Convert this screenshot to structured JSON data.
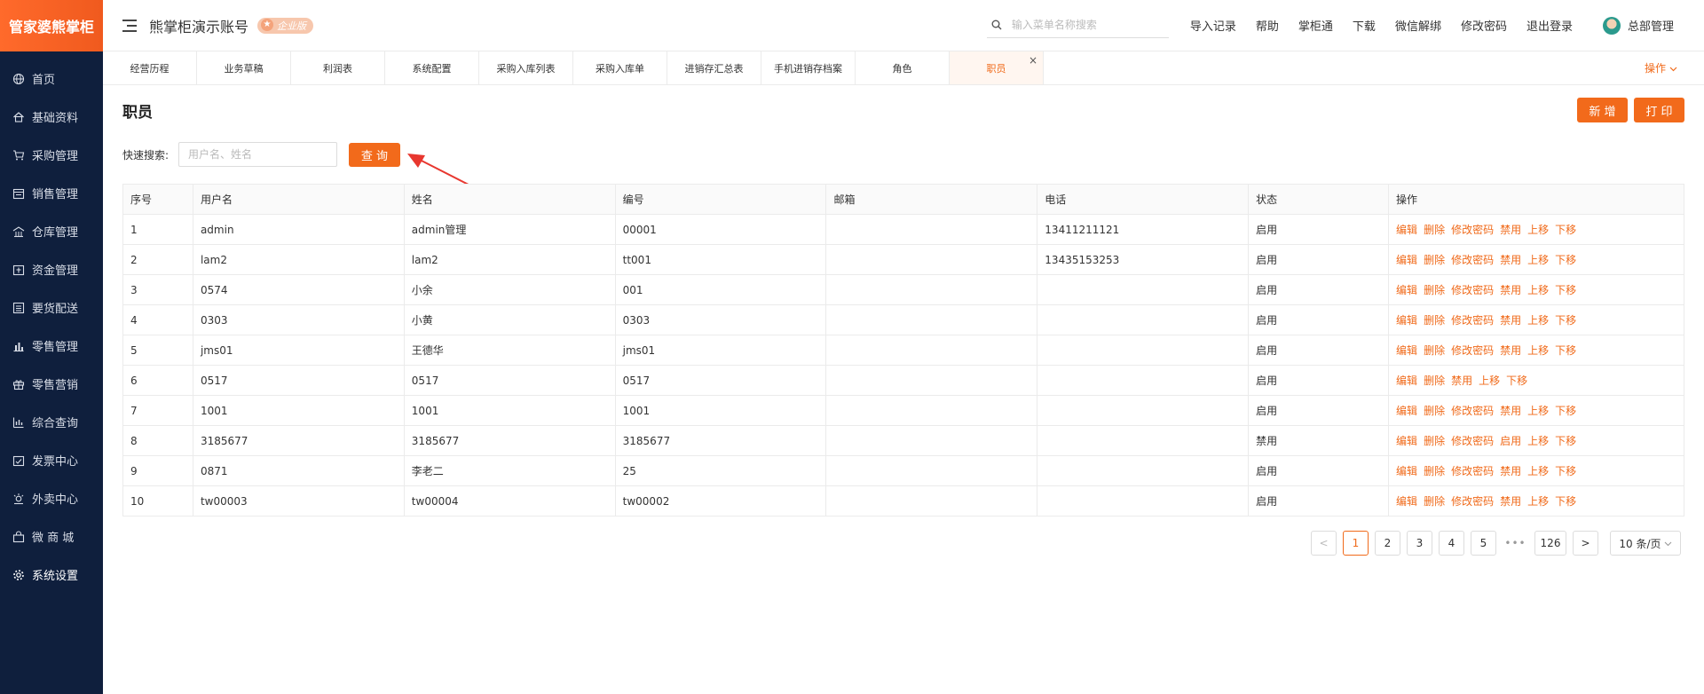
{
  "brand": {
    "logo_text": "管家婆熊掌柜"
  },
  "sidebar": {
    "items": [
      {
        "label": "首页",
        "icon": "globe-icon"
      },
      {
        "label": "基础资料",
        "icon": "home-icon"
      },
      {
        "label": "采购管理",
        "icon": "cart-icon"
      },
      {
        "label": "销售管理",
        "icon": "calendar-icon"
      },
      {
        "label": "仓库管理",
        "icon": "warehouse-icon"
      },
      {
        "label": "资金管理",
        "icon": "money-icon"
      },
      {
        "label": "要货配送",
        "icon": "list-icon"
      },
      {
        "label": "零售管理",
        "icon": "bar-chart-icon"
      },
      {
        "label": "零售营销",
        "icon": "gift-icon"
      },
      {
        "label": "综合查询",
        "icon": "analytics-icon"
      },
      {
        "label": "发票中心",
        "icon": "invoice-icon"
      },
      {
        "label": "外卖中心",
        "icon": "delivery-icon"
      },
      {
        "label": "微 商 城",
        "icon": "shop-icon"
      },
      {
        "label": "系统设置",
        "icon": "gear-icon"
      }
    ],
    "active_index": 13
  },
  "header": {
    "account_title": "熊掌柜演示账号",
    "edition_badge": "企业版",
    "search_placeholder": "输入菜单名称搜索",
    "links": [
      "导入记录",
      "帮助",
      "掌柜通",
      "下载",
      "微信解绑",
      "修改密码",
      "退出登录"
    ],
    "user_name": "总部管理"
  },
  "tabs": {
    "items": [
      "经营历程",
      "业务草稿",
      "利润表",
      "系统配置",
      "采购入库列表",
      "采购入库单",
      "进销存汇总表",
      "手机进销存档案",
      "角色",
      "职员"
    ],
    "active_index": 9,
    "close_symbol": "×",
    "operations_label": "操作"
  },
  "page": {
    "title": "职员",
    "new_button": "新 增",
    "print_button": "打 印",
    "quick_search_label": "快速搜索:",
    "quick_search_placeholder": "用户名、姓名",
    "query_button": "查 询"
  },
  "table": {
    "headers": [
      "序号",
      "用户名",
      "姓名",
      "编号",
      "邮箱",
      "电话",
      "状态",
      "操作"
    ],
    "rows": [
      {
        "no": "1",
        "username": "admin",
        "name": "admin管理",
        "code": "00001",
        "email": "",
        "phone": "13411211121",
        "status": "启用",
        "ops": [
          "编辑",
          "删除",
          "修改密码",
          "禁用",
          "上移",
          "下移"
        ]
      },
      {
        "no": "2",
        "username": "lam2",
        "name": "lam2",
        "code": "tt001",
        "email": "",
        "phone": "13435153253",
        "status": "启用",
        "ops": [
          "编辑",
          "删除",
          "修改密码",
          "禁用",
          "上移",
          "下移"
        ]
      },
      {
        "no": "3",
        "username": "0574",
        "name": "小余",
        "code": "001",
        "email": "",
        "phone": "",
        "status": "启用",
        "ops": [
          "编辑",
          "删除",
          "修改密码",
          "禁用",
          "上移",
          "下移"
        ]
      },
      {
        "no": "4",
        "username": "0303",
        "name": "小黄",
        "code": "0303",
        "email": "",
        "phone": "",
        "status": "启用",
        "ops": [
          "编辑",
          "删除",
          "修改密码",
          "禁用",
          "上移",
          "下移"
        ]
      },
      {
        "no": "5",
        "username": "jms01",
        "name": "王德华",
        "code": "jms01",
        "email": "",
        "phone": "",
        "status": "启用",
        "ops": [
          "编辑",
          "删除",
          "修改密码",
          "禁用",
          "上移",
          "下移"
        ]
      },
      {
        "no": "6",
        "username": "0517",
        "name": "0517",
        "code": "0517",
        "email": "",
        "phone": "",
        "status": "启用",
        "ops": [
          "编辑",
          "删除",
          "禁用",
          "上移",
          "下移"
        ]
      },
      {
        "no": "7",
        "username": "1001",
        "name": "1001",
        "code": "1001",
        "email": "",
        "phone": "",
        "status": "启用",
        "ops": [
          "编辑",
          "删除",
          "修改密码",
          "禁用",
          "上移",
          "下移"
        ]
      },
      {
        "no": "8",
        "username": "3185677",
        "name": "3185677",
        "code": "3185677",
        "email": "",
        "phone": "",
        "status": "禁用",
        "ops": [
          "编辑",
          "删除",
          "修改密码",
          "启用",
          "上移",
          "下移"
        ]
      },
      {
        "no": "9",
        "username": "0871",
        "name": "李老二",
        "code": "25",
        "email": "",
        "phone": "",
        "status": "启用",
        "ops": [
          "编辑",
          "删除",
          "修改密码",
          "禁用",
          "上移",
          "下移"
        ]
      },
      {
        "no": "10",
        "username": "tw00003",
        "name": "tw00004",
        "code": "tw00002",
        "email": "",
        "phone": "",
        "status": "启用",
        "ops": [
          "编辑",
          "删除",
          "修改密码",
          "禁用",
          "上移",
          "下移"
        ]
      }
    ]
  },
  "pagination": {
    "prev": "<",
    "next": ">",
    "pages": [
      "1",
      "2",
      "3",
      "4",
      "5"
    ],
    "current": "1",
    "ellipsis": "•••",
    "last_page": "126",
    "page_size": "10 条/页"
  },
  "colors": {
    "accent": "#f26a1b",
    "sidebar_bg": "#0f1f3d",
    "annotation_arrow": "#e8372f"
  }
}
